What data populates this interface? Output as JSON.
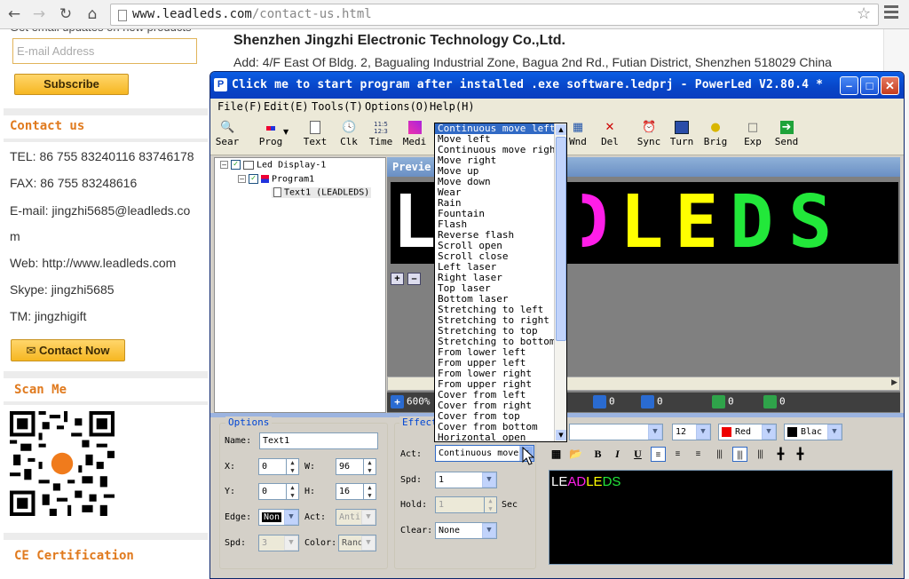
{
  "browser": {
    "url_host": "www.leadleds.com",
    "url_path": "/contact-us.html"
  },
  "site": {
    "email_placeholder": "E-mail Address",
    "subscribe_label": "Subscribe",
    "contact_heading": "Contact us",
    "tel": "TEL: 86 755 83240116  83746178",
    "fax": "FAX: 86 755 83248616",
    "email_line1": "E-mail: jingzhi5685@leadleds.co",
    "email_line2": "m",
    "web": "Web: http://www.leadleds.com",
    "skype": "Skype: jingzhi5685",
    "tm": "TM: jingzhigift",
    "contact_now_label": "Contact Now",
    "scan_heading": "Scan Me",
    "ce_heading": "CE Certification",
    "company_name": "Shenzhen Jingzhi Electronic Technology Co.,Ltd.",
    "address": "Add: 4/F East Of Bldg. 2, Bagualing Industrial Zone,  Bagua 2nd Rd., Futian District, Shenzhen 518029 China"
  },
  "powerled": {
    "title": "Click me to start program after installed .exe software.ledprj - PowerLed V2.80.4 *",
    "menus": [
      "File(F)",
      "Edit(E)",
      "Tools(T)",
      "Options(O)",
      "Help(H)"
    ],
    "toolbar": [
      "Sear",
      "Prog",
      "Text",
      "Clk",
      "Time",
      "Medi",
      "Wnd",
      "Del",
      "Sync",
      "Turn",
      "Brig",
      "Exp",
      "Send"
    ],
    "tree": {
      "display": "Led Display-1",
      "program": "Program1",
      "text": "Text1 (LEADLEDS)"
    },
    "preview_title": "Previe",
    "led_text": "LEADLEDS",
    "status": {
      "zoom": "600%",
      "v1": "0",
      "v2": "0",
      "v3": "0",
      "v4": "0"
    },
    "options": {
      "title": "Options",
      "name_label": "Name:",
      "name_value": "Text1",
      "x_label": "X:",
      "x_value": "0",
      "w_label": "W:",
      "w_value": "96",
      "y_label": "Y:",
      "y_value": "0",
      "h_label": "H:",
      "h_value": "16",
      "edge_label": "Edge:",
      "edge_value": "Non",
      "act_label": "Act:",
      "act_value": "Anti",
      "spd_label": "Spd:",
      "spd_value": "3",
      "color_label": "Color:",
      "color_value": "Rand"
    },
    "effect": {
      "title": "Effect",
      "act_label": "Act:",
      "act_value": "Continuous move",
      "spd_label": "Spd:",
      "spd_value": "1",
      "hold_label": "Hold:",
      "hold_value": "1",
      "hold_unit": "Sec",
      "clear_label": "Clear:",
      "clear_value": "None"
    },
    "text_format": {
      "font_size": "12",
      "color": "Red",
      "bg_color": "Blac",
      "editor_text": [
        "LE",
        "AD",
        "LE",
        "DS"
      ]
    },
    "effect_options": [
      "Continuous move left",
      "Move left",
      "Continuous move right",
      "Move right",
      "Move up",
      "Move down",
      "Wear",
      "Rain",
      "Fountain",
      "Flash",
      "Reverse flash",
      "Scroll open",
      "Scroll close",
      "Left laser",
      "Right laser",
      "Top laser",
      "Bottom laser",
      "Stretching to left",
      "Stretching to right",
      "Stretching to top",
      "Stretching to bottom",
      "From lower left",
      "From upper left",
      "From lower right",
      "From upper right",
      "Cover from left",
      "Cover from right",
      "Cover from top",
      "Cover from bottom",
      "Horizontal open"
    ],
    "selected_effect": "Continuous move left"
  },
  "colors": {
    "led_white": "#ffffff",
    "led_magenta": "#ff1ee8",
    "led_yellow": "#ffff00",
    "led_green": "#22e83a",
    "title_blue": "#0845c7",
    "accent_orange": "#e07a1e"
  }
}
